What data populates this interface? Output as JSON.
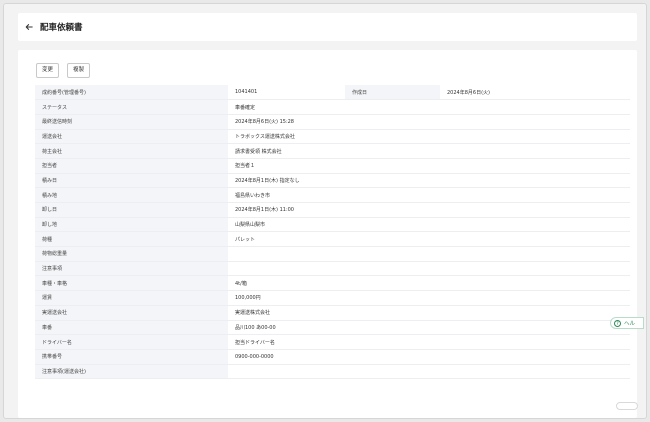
{
  "header": {
    "title": "配車依頼書"
  },
  "toolbar": {
    "change_label": "変更",
    "copy_label": "複製"
  },
  "detail": {
    "first_row": {
      "label": "成約番号(管理番号)",
      "value": "1041401",
      "label2": "作成日",
      "value2": "2024年8月6日(火)"
    },
    "rows": [
      {
        "label": "ステータス",
        "value": "車番確定"
      },
      {
        "label": "最終送信時刻",
        "value": "2024年8月6日(火) 15:28"
      },
      {
        "label": "運送会社",
        "value": "トラボックス運送株式会社"
      },
      {
        "label": "荷主会社",
        "value": "請求書受領 株式会社"
      },
      {
        "label": "担当者",
        "value": "担当者１"
      },
      {
        "label": "積み日",
        "value": "2024年8月1日(木) 指定なし"
      },
      {
        "label": "積み地",
        "value": "福島県いわき市"
      },
      {
        "label": "卸し日",
        "value": "2024年8月1日(木) 11:00"
      },
      {
        "label": "卸し地",
        "value": "山梨県山梨市"
      },
      {
        "label": "荷種",
        "value": "パレット"
      },
      {
        "label": "荷物総重量",
        "value": ""
      },
      {
        "label": "注意事項",
        "value": ""
      },
      {
        "label": "車種・車格",
        "value": "4t/箱"
      },
      {
        "label": "運賃",
        "value": "100,000円"
      },
      {
        "label": "実運送会社",
        "value": "実運送株式会社"
      },
      {
        "label": "車番",
        "value": "品川100 あ00-00"
      },
      {
        "label": "ドライバー名",
        "value": "担当ドライバー名"
      },
      {
        "label": "携帯番号",
        "value": "0900-000-0000"
      },
      {
        "label": "注意事項(運送会社)",
        "value": ""
      }
    ]
  },
  "help": {
    "label": "ヘル"
  }
}
